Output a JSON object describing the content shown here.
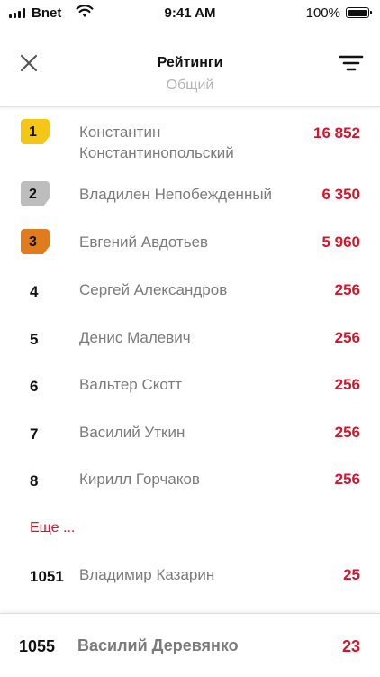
{
  "status_bar": {
    "carrier": "Bnet",
    "time": "9:41 AM",
    "battery": "100%"
  },
  "nav": {
    "title": "Рейтинги",
    "subtitle": "Общий"
  },
  "ratings": [
    {
      "rank": "1",
      "name": "Константин Константинопольский",
      "score": "16 852",
      "medal": "gold"
    },
    {
      "rank": "2",
      "name": "Владилен Непобежденный",
      "score": "6 350",
      "medal": "silver"
    },
    {
      "rank": "3",
      "name": "Евгений Авдотьев",
      "score": "5 960",
      "medal": "bronze"
    },
    {
      "rank": "4",
      "name": "Сергей Александров",
      "score": "256"
    },
    {
      "rank": "5",
      "name": "Денис Малевич",
      "score": "256"
    },
    {
      "rank": "6",
      "name": "Вальтер Скотт",
      "score": "256"
    },
    {
      "rank": "7",
      "name": "Василий Уткин",
      "score": "256"
    },
    {
      "rank": "8",
      "name": "Кирилл Горчаков",
      "score": "256"
    }
  ],
  "more_label": "Еще ...",
  "extra_row": {
    "rank": "1051",
    "name": "Владимир Казарин",
    "score": "25"
  },
  "current_user": {
    "rank": "1055",
    "name": "Василий Деревянко",
    "score": "23"
  },
  "colors": {
    "accent": "#d3162b",
    "gold": "#f5c518",
    "silver": "#bdbdbd",
    "bronze": "#e07c1c",
    "name_gray": "#7b7b7b"
  },
  "icons": {
    "close": "close-icon",
    "filter": "filter-icon"
  }
}
